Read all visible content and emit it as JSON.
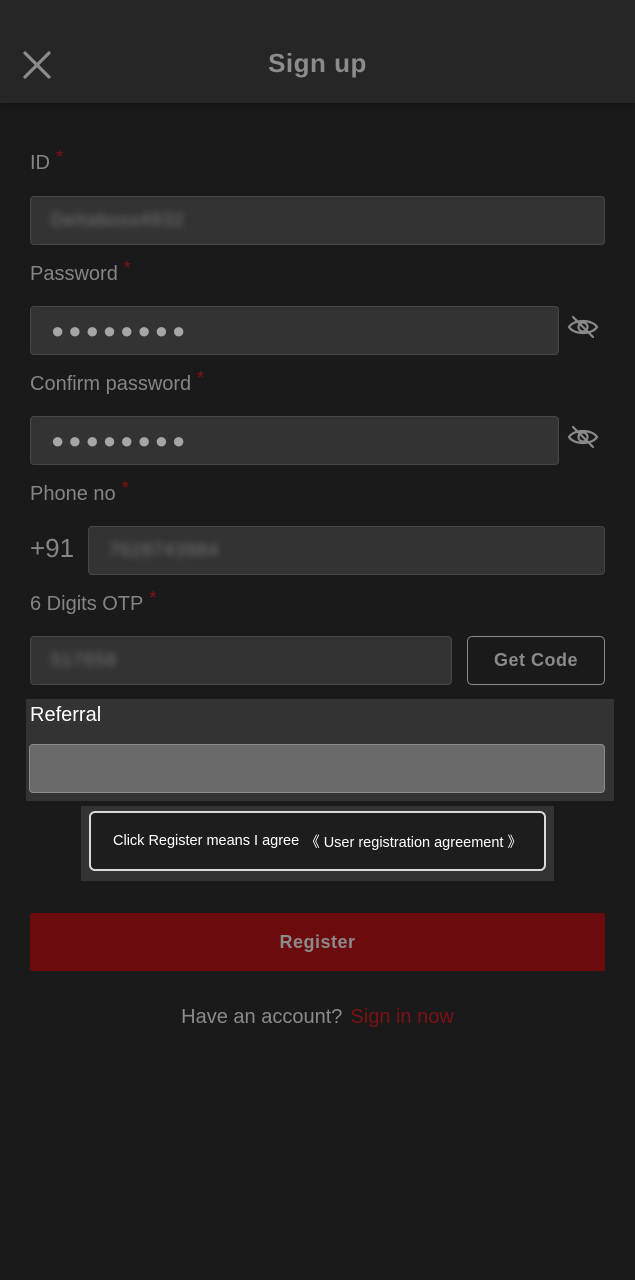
{
  "header": {
    "title": "Sign up",
    "close_icon": "close-icon"
  },
  "form": {
    "id": {
      "label": "ID",
      "required_mark": "*",
      "value": "Deltaboss4932"
    },
    "password": {
      "label": "Password",
      "required_mark": "*",
      "value": "●●●●●●●●",
      "toggle_icon": "eye-slash-icon"
    },
    "confirm_password": {
      "label": "Confirm password",
      "required_mark": "*",
      "value": "●●●●●●●●",
      "toggle_icon": "eye-slash-icon"
    },
    "phone": {
      "label": "Phone no",
      "required_mark": "*",
      "country_code": "+91",
      "value": "7628743984"
    },
    "otp": {
      "label": "6 Digits OTP",
      "required_mark": "*",
      "value": "517658",
      "get_code_label": "Get Code"
    },
    "referral": {
      "label": "Referral",
      "value": ""
    }
  },
  "agreement": {
    "text": "Click Register means I agree",
    "link": "《 User registration agreement 》"
  },
  "register_button": {
    "label": "Register"
  },
  "footer": {
    "prompt": "Have an account?",
    "signin_link": "Sign in now"
  },
  "colors": {
    "background": "#1a1a1a",
    "header": "#262626",
    "field": "#333333",
    "register_button": "#6b0b0d",
    "required_mark": "#8a1010",
    "signin_link": "#7a1113"
  }
}
